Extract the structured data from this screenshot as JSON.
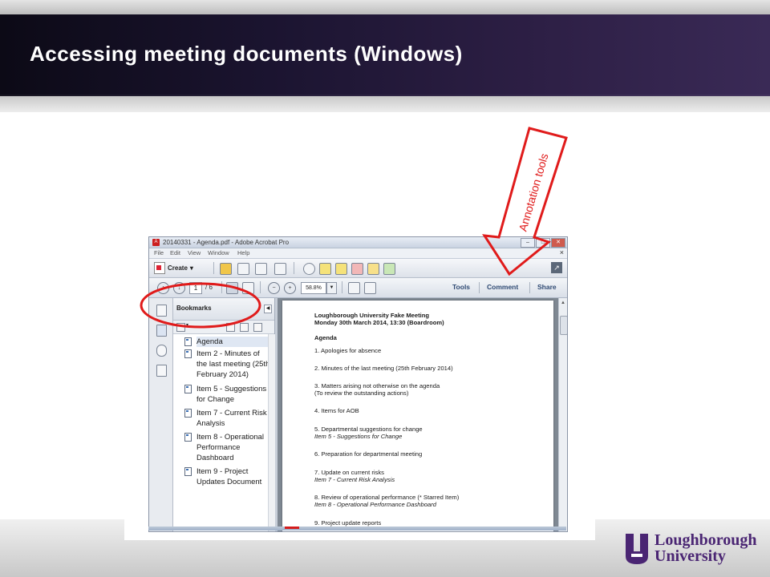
{
  "slide": {
    "title": "Accessing meeting documents (Windows)",
    "logo_line1": "Loughborough",
    "logo_line2": "University",
    "brand_color": "#4a2573"
  },
  "annotation": {
    "label": "Annotation tools",
    "color": "#e01b1b"
  },
  "acrobat": {
    "window_title": "20140331 - Agenda.pdf - Adobe Acrobat Pro",
    "menu": [
      "File",
      "Edit",
      "View",
      "Window",
      "Help"
    ],
    "create_label": "Create",
    "page_current": "1",
    "page_total": "/ 6",
    "zoom_value": "58.8%",
    "panel_buttons": [
      "Tools",
      "Comment",
      "Share"
    ],
    "bookmarks_title": "Bookmarks",
    "bookmarks": [
      {
        "label": "Agenda"
      },
      {
        "label": "Item 2 - Minutes of the last meeting (25th February 2014)"
      },
      {
        "label": "Item 5 - Suggestions for Change"
      },
      {
        "label": "Item 7 - Current Risk Analysis"
      },
      {
        "label": "Item 8 - Operational Performance Dashboard"
      },
      {
        "label": "Item 9 - Project Updates Document"
      }
    ],
    "document": {
      "heading1": "Loughborough University Fake Meeting",
      "heading2": "Monday 30th March 2014, 13:30 (Boardroom)",
      "agenda_title": "Agenda",
      "lines": [
        {
          "text": "1. Apologies for absence",
          "style": "normal"
        },
        {
          "text": "2. Minutes of the last meeting (25th February 2014)",
          "style": "normal"
        },
        {
          "text": "3. Matters arising not otherwise on the agenda",
          "style": "normal"
        },
        {
          "text": "(To review the outstanding actions)",
          "style": "normal"
        },
        {
          "text": "4. Items for AOB",
          "style": "normal"
        },
        {
          "text": "5. Departmental suggestions for change",
          "style": "normal"
        },
        {
          "text": "Item 5 - Suggestions for Change",
          "style": "italic"
        },
        {
          "text": "6. Preparation for departmental meeting",
          "style": "normal"
        },
        {
          "text": "7. Update on current risks",
          "style": "normal"
        },
        {
          "text": "Item 7 - Current Risk Analysis",
          "style": "italic"
        },
        {
          "text": "8. Review of operational performance (* Starred Item)",
          "style": "normal"
        },
        {
          "text": "Item 8 - Operational Performance Dashboard",
          "style": "italic"
        },
        {
          "text": "9. Project update reports",
          "style": "normal"
        }
      ]
    }
  }
}
